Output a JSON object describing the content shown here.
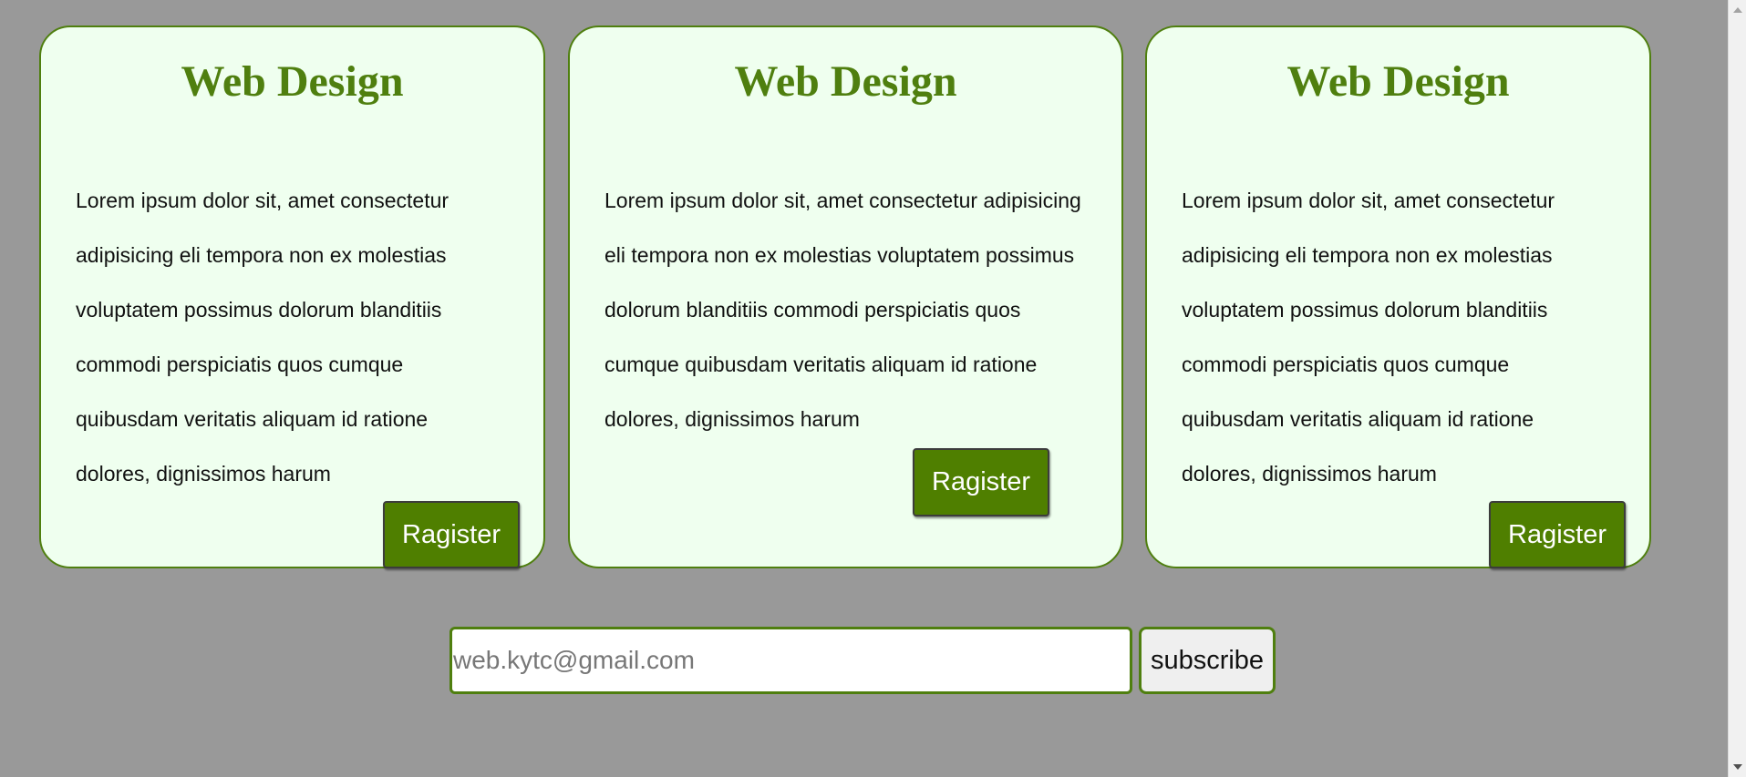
{
  "cards": [
    {
      "title": "Web Design",
      "text": "Lorem ipsum dolor sit, amet consectetur adipisicing eli tempora non ex molestias voluptatem possimus dolorum blanditiis commodi perspiciatis quos cumque quibusdam veritatis aliquam id ratione dolores, dignissimos harum",
      "button_label": "Ragister"
    },
    {
      "title": "Web Design",
      "text": "Lorem ipsum dolor sit, amet consectetur adipisicing eli tempora non ex molestias voluptatem possimus dolorum blanditiis commodi perspiciatis quos cumque quibusdam veritatis aliquam id ratione dolores, dignissimos harum",
      "button_label": "Ragister"
    },
    {
      "title": "Web Design",
      "text": "Lorem ipsum dolor sit, amet consectetur adipisicing eli tempora non ex molestias voluptatem possimus dolorum blanditiis commodi perspiciatis quos cumque quibusdam veritatis aliquam id ratione dolores, dignissimos harum",
      "button_label": "Ragister"
    }
  ],
  "subscribe": {
    "email_placeholder": "web.kytc@gmail.com",
    "email_value": "",
    "button_label": "subscribe"
  },
  "colors": {
    "background": "#999999",
    "card_background": "#efffef",
    "accent_green": "#4f7f0f",
    "button_text": "#ffffff"
  },
  "icons": {
    "scroll_up": "scroll-up-arrow-icon",
    "scroll_down": "scroll-down-arrow-icon"
  }
}
